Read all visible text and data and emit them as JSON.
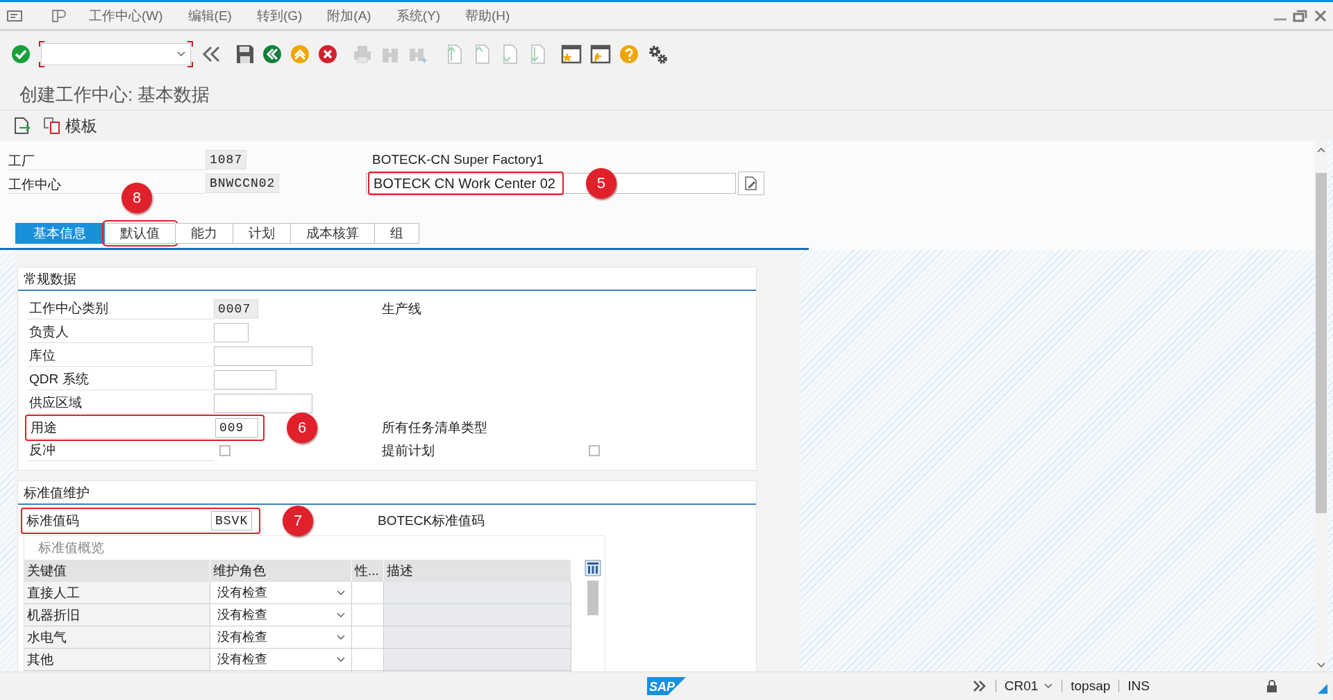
{
  "menu_bar": {
    "items": [
      "工作中心(W)",
      "编辑(E)",
      "转到(G)",
      "附加(A)",
      "系统(Y)",
      "帮助(H)"
    ]
  },
  "title": "创建工作中心: 基本数据",
  "app_toolbar": {
    "buttons": [
      {
        "label": "模板"
      }
    ]
  },
  "header": {
    "rows": [
      {
        "label": "工厂",
        "value": "1087",
        "description": {
          "kind": "text",
          "text": "BOTECK-CN Super Factory1"
        }
      },
      {
        "label": "工作中心",
        "value": "BNWCCN02",
        "description": {
          "kind": "field",
          "text": "BOTECK CN Work Center 02",
          "annotation": "5"
        }
      }
    ]
  },
  "tabs": [
    {
      "label": "基本信息",
      "selected": true
    },
    {
      "label": "默认值",
      "selected": false,
      "annotation": "8"
    },
    {
      "label": "能力",
      "selected": false
    },
    {
      "label": "计划",
      "selected": false
    },
    {
      "label": "成本核算",
      "selected": false
    },
    {
      "label": "组",
      "selected": false
    }
  ],
  "general_data": {
    "title": "常规数据",
    "rows": [
      {
        "label": "工作中心类别",
        "control": {
          "kind": "field",
          "value": "0007",
          "readonly": true
        },
        "side": {
          "label": "生产线"
        }
      },
      {
        "label": "负责人",
        "control": {
          "kind": "field",
          "readonly": false
        }
      },
      {
        "label": "库位",
        "control": {
          "kind": "field",
          "readonly": false
        }
      },
      {
        "label": "QDR 系统",
        "control": {
          "kind": "field",
          "readonly": false
        }
      },
      {
        "label": "供应区域",
        "control": {
          "kind": "field",
          "readonly": false
        }
      },
      {
        "label": "用途",
        "control": {
          "kind": "field",
          "value": "009",
          "readonly": false
        },
        "annotation": "6",
        "side": {
          "label": "所有任务清单类型"
        }
      },
      {
        "label": "反冲",
        "control": {
          "kind": "checkbox",
          "checked": false
        },
        "side": {
          "label": "提前计划",
          "control": {
            "kind": "checkbox",
            "checked": false
          }
        }
      }
    ]
  },
  "standard_values": {
    "title": "标准值维护",
    "code": {
      "label": "标准值码",
      "value": "BSVK",
      "annotation": "7",
      "description": "BOTECK标准值码"
    },
    "table": {
      "title": "标准值概览",
      "columns": [
        "关键值",
        "维护角色",
        "性...",
        "描述"
      ],
      "rows": [
        {
          "key": "直接人工",
          "role": "没有检查"
        },
        {
          "key": "机器折旧",
          "role": "没有检查"
        },
        {
          "key": "水电气",
          "role": "没有检查"
        },
        {
          "key": "其他",
          "role": "没有检查"
        }
      ]
    }
  },
  "status_bar": {
    "logo": "SAP",
    "transaction": "CR01",
    "server": "topsap",
    "mode": "INS"
  }
}
